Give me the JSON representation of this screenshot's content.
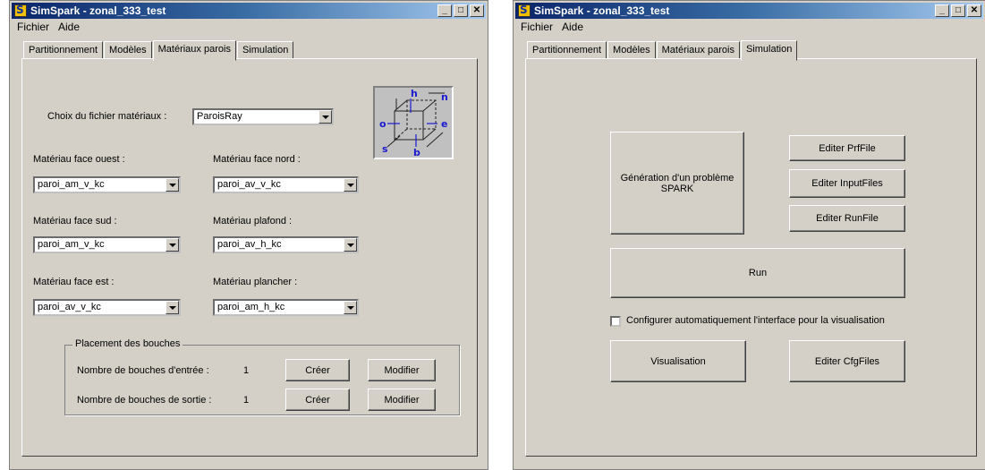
{
  "windows": [
    {
      "title": "SimSpark - zonal_333_test",
      "menu": [
        "Fichier",
        "Aide"
      ],
      "tabs": [
        "Partitionnement",
        "Modèles",
        "Matériaux parois",
        "Simulation"
      ],
      "active_tab": "Matériaux parois",
      "materials": {
        "file_label": "Choix du fichier matériaux :",
        "file_value": "ParoisRay",
        "west_label": "Matériau face ouest :",
        "west_value": "paroi_am_v_kc",
        "north_label": "Matériau face nord :",
        "north_value": "paroi_av_v_kc",
        "south_label": "Matériau face sud :",
        "south_value": "paroi_am_v_kc",
        "ceiling_label": "Matériau plafond :",
        "ceiling_value": "paroi_av_h_kc",
        "east_label": "Matériau face est :",
        "east_value": "paroi_av_v_kc",
        "floor_label": "Matériau plancher :",
        "floor_value": "paroi_am_h_kc"
      },
      "cube_labels": {
        "h": "h",
        "n": "n",
        "o": "o",
        "e": "e",
        "s": "s",
        "b": "b"
      },
      "vents": {
        "legend": "Placement des bouches",
        "inlet_label": "Nombre de bouches d'entrée :",
        "inlet_count": "1",
        "outlet_label": "Nombre de bouches de sortie :",
        "outlet_count": "1",
        "create_label": "Créer",
        "modify_label": "Modifier"
      }
    },
    {
      "title": "SimSpark - zonal_333_test",
      "menu": [
        "Fichier",
        "Aide"
      ],
      "tabs": [
        "Partitionnement",
        "Modèles",
        "Matériaux parois",
        "Simulation"
      ],
      "active_tab": "Simulation",
      "simulation": {
        "generate_label": "Génération d'un problème SPARK",
        "edit_prf_label": "Editer PrfFile",
        "edit_input_label": "Editer InputFiles",
        "edit_run_label": "Editer RunFile",
        "run_label": "Run",
        "auto_config_label": "Configurer automatiquement l'interface pour la visualisation",
        "auto_config_checked": false,
        "visualisation_label": "Visualisation",
        "edit_cfg_label": "Editer CfgFiles"
      }
    }
  ],
  "colors": {
    "face": "#d4d0c8",
    "title_start": "#0a246a",
    "title_end": "#a6caf0",
    "cube_blue": "#1a1ad0"
  }
}
